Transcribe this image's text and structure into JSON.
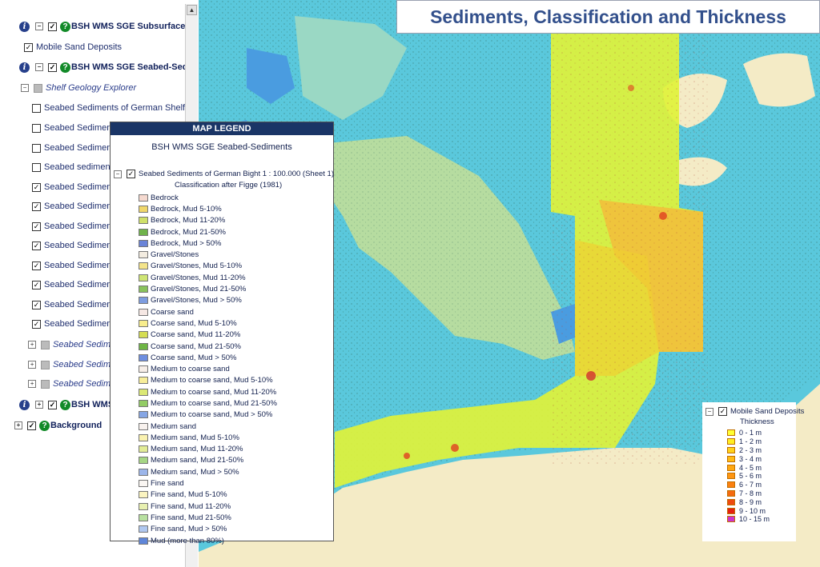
{
  "title": "Sediments, Classification and Thickness",
  "tree": {
    "rows": [
      {
        "type": "group",
        "label": "BSH WMS SGE Subsurface-S",
        "info": true,
        "expander": "−",
        "checked": true,
        "help": true
      },
      {
        "type": "layer",
        "label": "Mobile Sand Deposits",
        "checked": true
      },
      {
        "type": "group",
        "label": "BSH WMS SGE Seabed-Sedi",
        "info": true,
        "expander": "−",
        "checked": true,
        "help": true
      },
      {
        "type": "folder",
        "label": "Shelf Geology Explorer",
        "expander": "−",
        "checked": false,
        "gray": true
      },
      {
        "type": "layer",
        "label": "Seabed Sediments of German Shelf",
        "checked": false
      },
      {
        "type": "layer",
        "label": "Seabed Sediments",
        "checked": false
      },
      {
        "type": "layer",
        "label": "Seabed Sediments",
        "checked": false
      },
      {
        "type": "layer",
        "label": "Seabed sediments",
        "checked": false
      },
      {
        "type": "layer",
        "label": "Seabed Sediments",
        "checked": true
      },
      {
        "type": "layer",
        "label": "Seabed Sediments",
        "checked": true
      },
      {
        "type": "layer",
        "label": "Seabed Sediments",
        "checked": true
      },
      {
        "type": "layer",
        "label": "Seabed Sediments",
        "checked": true
      },
      {
        "type": "layer",
        "label": "Seabed Sediments",
        "checked": true
      },
      {
        "type": "layer",
        "label": "Seabed Sediments",
        "checked": true
      },
      {
        "type": "layer",
        "label": "Seabed Sediments",
        "checked": true
      },
      {
        "type": "layer",
        "label": "Seabed Sediments",
        "checked": true
      },
      {
        "type": "folder",
        "label": "Seabed Sedim",
        "expander": "+",
        "checked": false,
        "gray": true
      },
      {
        "type": "folder",
        "label": "Seabed Sedim",
        "expander": "+",
        "checked": false,
        "gray": true
      },
      {
        "type": "folder",
        "label": "Seabed Sedim",
        "expander": "+",
        "checked": false,
        "gray": true
      },
      {
        "type": "group",
        "label": "BSH WMS",
        "info": true,
        "expander": "+",
        "checked": true,
        "help": true
      },
      {
        "type": "group",
        "label": "Background",
        "info": false,
        "expander": "+",
        "checked": true,
        "help": true
      }
    ]
  },
  "legend": {
    "header": "MAP LEGEND",
    "service": "BSH WMS SGE Seabed-Sediments",
    "layer_label": "Seabed Sediments of German Bight 1 : 100.000 (Sheet 1)",
    "classification": "Classification after Figge (1981)",
    "items": [
      {
        "label": "Bedrock",
        "color": "#f5d9cf"
      },
      {
        "label": "Bedrock, Mud 5-10%",
        "color": "#f0d76a"
      },
      {
        "label": "Bedrock, Mud 11-20%",
        "color": "#cfe06a"
      },
      {
        "label": "Bedrock, Mud 21-50%",
        "color": "#6fb24a"
      },
      {
        "label": "Bedrock, Mud > 50%",
        "color": "#6a84d8"
      },
      {
        "label": "Gravel/Stones",
        "color": "#f3ece0"
      },
      {
        "label": "Gravel/Stones, Mud 5-10%",
        "color": "#f4e48a"
      },
      {
        "label": "Gravel/Stones, Mud 11-20%",
        "color": "#cfe574"
      },
      {
        "label": "Gravel/Stones, Mud 21-50%",
        "color": "#89c25c"
      },
      {
        "label": "Gravel/Stones, Mud > 50%",
        "color": "#7e9de0"
      },
      {
        "label": "Coarse sand",
        "color": "#f6e8e4"
      },
      {
        "label": "Coarse sand, Mud 5-10%",
        "color": "#f8ed8c"
      },
      {
        "label": "Coarse sand, Mud 11-20%",
        "color": "#d5dd52"
      },
      {
        "label": "Coarse sand, Mud 21-50%",
        "color": "#6eb544"
      },
      {
        "label": "Coarse sand, Mud > 50%",
        "color": "#6d8ee0"
      },
      {
        "label": "Medium to coarse sand",
        "color": "#f7eee8"
      },
      {
        "label": "Medium to coarse sand, Mud 5-10%",
        "color": "#f8ee9a"
      },
      {
        "label": "Medium to coarse sand, Mud 11-20%",
        "color": "#dbe874"
      },
      {
        "label": "Medium to coarse sand, Mud 21-50%",
        "color": "#93cc64"
      },
      {
        "label": "Medium to coarse sand, Mud > 50%",
        "color": "#86a6e4"
      },
      {
        "label": "Medium sand",
        "color": "#f8f2ee"
      },
      {
        "label": "Medium sand, Mud 5-10%",
        "color": "#faf2b0"
      },
      {
        "label": "Medium sand, Mud 11-20%",
        "color": "#e2ec96"
      },
      {
        "label": "Medium sand, Mud 21-50%",
        "color": "#a6d684"
      },
      {
        "label": "Medium sand, Mud > 50%",
        "color": "#9cb6ea"
      },
      {
        "label": "Fine sand",
        "color": "#faf6f2"
      },
      {
        "label": "Fine sand, Mud 5-10%",
        "color": "#fbf4c0"
      },
      {
        "label": "Fine sand, Mud 11-20%",
        "color": "#e8f0b0"
      },
      {
        "label": "Fine sand, Mud 21-50%",
        "color": "#b8e0a0"
      },
      {
        "label": "Fine sand, Mud > 50%",
        "color": "#b0c8f0"
      },
      {
        "label": "Mud (more than 80%)",
        "color": "#5f86d8"
      }
    ]
  },
  "thickness_legend": {
    "layer_label": "Mobile Sand Deposits",
    "title": "Thickness",
    "items": [
      {
        "label": "0 - 1 m",
        "color": "#ffff33"
      },
      {
        "label": "1 - 2 m",
        "color": "#ffee22"
      },
      {
        "label": "2 - 3 m",
        "color": "#ffd21a"
      },
      {
        "label": "3 - 4 m",
        "color": "#ffbb15"
      },
      {
        "label": "4 - 5 m",
        "color": "#ffa812"
      },
      {
        "label": "5 - 6 m",
        "color": "#ff9510"
      },
      {
        "label": "6 - 7 m",
        "color": "#fb8010"
      },
      {
        "label": "7 - 8 m",
        "color": "#f56a10"
      },
      {
        "label": "8 - 9 m",
        "color": "#ee4a10"
      },
      {
        "label": "9 - 10 m",
        "color": "#e52010"
      },
      {
        "label": "10 - 15 m",
        "color": "#cc33cc"
      }
    ]
  },
  "map_colors": {
    "land": "#f4ebc6",
    "water": "#5ac8dc",
    "fine_sand": "#9ad8c4",
    "mud": "#4a9ce0",
    "green_sediment": "#b6dca0",
    "sand_yellow": "#dff23a",
    "thick_orange": "#f5b93a",
    "dot_red": "#c0503c"
  }
}
